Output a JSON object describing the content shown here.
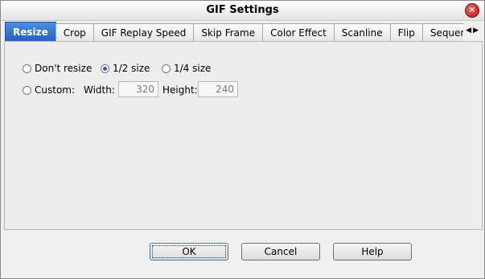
{
  "window": {
    "title": "GIF Settings",
    "close_glyph": "×"
  },
  "tabs": [
    {
      "label": "Resize",
      "active": true
    },
    {
      "label": "Crop"
    },
    {
      "label": "GIF Replay Speed"
    },
    {
      "label": "Skip Frame"
    },
    {
      "label": "Color Effect"
    },
    {
      "label": "Scanline"
    },
    {
      "label": "Flip"
    },
    {
      "label": "Sequence"
    }
  ],
  "tab_scroll": {
    "left_glyph": "◀",
    "right_glyph": "▶"
  },
  "resize": {
    "options": [
      {
        "label": "Don't resize",
        "selected": false
      },
      {
        "label": "1/2 size",
        "selected": true
      },
      {
        "label": "1/4 size",
        "selected": false
      },
      {
        "label": "Custom:",
        "selected": false
      }
    ],
    "width_label": "Width:",
    "width_value": "320",
    "height_label": "Height:",
    "height_value": "240"
  },
  "buttons": {
    "ok": "OK",
    "cancel": "Cancel",
    "help": "Help"
  },
  "colors": {
    "active_tab": "#1f5fbf",
    "radio_selected": "#1e5fc0"
  }
}
